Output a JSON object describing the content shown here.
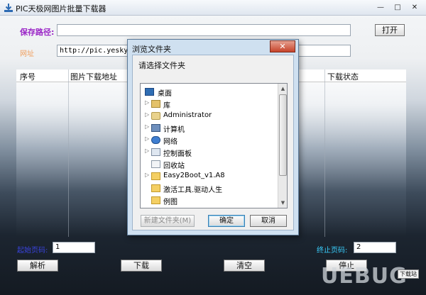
{
  "window": {
    "title": "PIC天极网图片批量下载器",
    "min_glyph": "—",
    "max_glyph": "□",
    "close_glyph": "✕"
  },
  "form": {
    "save_path_label": "保存路径:",
    "save_path_value": "",
    "open_button": "打开",
    "url_label": "网址",
    "url_value": "http://pic.yesky.com/3"
  },
  "table": {
    "columns": [
      "序号",
      "图片下载地址",
      "下载状态"
    ]
  },
  "pages": {
    "start_label": "起始页码:",
    "start_value": "1",
    "end_label": "终止页码:",
    "end_value": "2"
  },
  "buttons": {
    "parse": "解析",
    "download": "下载",
    "clear": "清空",
    "stop": "停止"
  },
  "watermark": {
    "text": "UEBUG",
    "badge": "下载站"
  },
  "dialog": {
    "title": "浏览文件夹",
    "close_glyph": "✕",
    "instruction": "请选择文件夹",
    "tree": [
      {
        "label": "桌面",
        "icon": "desktop-icon",
        "expandable": false,
        "level": 0
      },
      {
        "label": "库",
        "icon": "library-icon",
        "expandable": true,
        "level": 1
      },
      {
        "label": "Administrator",
        "icon": "user-folder-icon",
        "expandable": true,
        "level": 1
      },
      {
        "label": "计算机",
        "icon": "computer-icon",
        "expandable": true,
        "level": 1
      },
      {
        "label": "网络",
        "icon": "network-icon",
        "expandable": true,
        "level": 1
      },
      {
        "label": "控制面板",
        "icon": "control-panel-icon",
        "expandable": true,
        "level": 1
      },
      {
        "label": "回收站",
        "icon": "recycle-bin-icon",
        "expandable": false,
        "level": 1
      },
      {
        "label": "Easy2Boot_v1.A8",
        "icon": "folder-icon",
        "expandable": true,
        "level": 1
      },
      {
        "label": "激活工具.驱动人生",
        "icon": "folder-icon",
        "expandable": false,
        "level": 1
      },
      {
        "label": "例图",
        "icon": "folder-icon",
        "expandable": false,
        "level": 1
      }
    ],
    "scroll_up_glyph": "▲",
    "scroll_down_glyph": "▼",
    "new_folder_button": "新建文件夹(M)",
    "ok_button": "确定",
    "cancel_button": "取消"
  }
}
